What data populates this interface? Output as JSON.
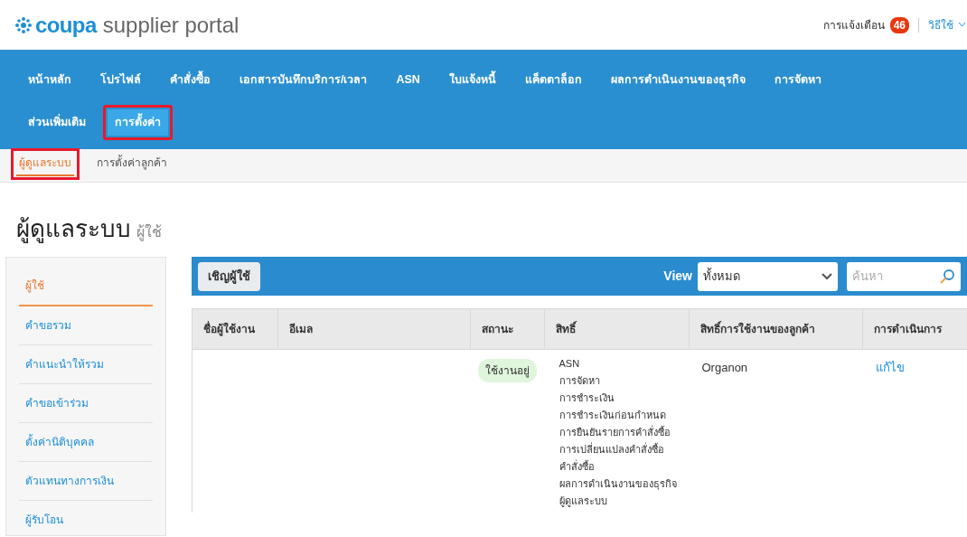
{
  "header": {
    "logo_brand": "coupa",
    "logo_product": "supplier portal",
    "notifications_label": "การแจ้งเตือน",
    "notifications_count": "46",
    "help": "วิธีใช้"
  },
  "nav": [
    {
      "label": "หน้าหลัก",
      "selected": false,
      "highlighted": false
    },
    {
      "label": "โปรไฟล์",
      "selected": false,
      "highlighted": false
    },
    {
      "label": "คำสั่งซื้อ",
      "selected": false,
      "highlighted": false
    },
    {
      "label": "เอกสารบันทึกบริการ/เวลา",
      "selected": false,
      "highlighted": false
    },
    {
      "label": "ASN",
      "selected": false,
      "highlighted": false
    },
    {
      "label": "ใบแจ้งหนี้",
      "selected": false,
      "highlighted": false
    },
    {
      "label": "แค็ตตาล็อก",
      "selected": false,
      "highlighted": false
    },
    {
      "label": "ผลการดำเนินงานของธุรกิจ",
      "selected": false,
      "highlighted": false
    },
    {
      "label": "การจัดหา",
      "selected": false,
      "highlighted": false
    },
    {
      "label": "ส่วนเพิ่มเติม",
      "selected": false,
      "highlighted": false
    },
    {
      "label": "การตั้งค่า",
      "selected": true,
      "highlighted": true
    }
  ],
  "subnav": [
    {
      "label": "ผู้ดูแลระบบ",
      "selected": true,
      "highlighted": true
    },
    {
      "label": "การตั้งค่าลูกค้า",
      "selected": false,
      "highlighted": false
    }
  ],
  "page_title": "ผู้ดูแลระบบ",
  "page_subtitle": "ผู้ใช้",
  "sidebar": {
    "items": [
      {
        "label": "ผู้ใช้",
        "selected": true
      },
      {
        "label": "คำขอรวม",
        "selected": false
      },
      {
        "label": "คำแนะนำให้รวม",
        "selected": false
      },
      {
        "label": "คำขอเข้าร่วม",
        "selected": false
      },
      {
        "label": "ตั้งค่านิติบุคคล",
        "selected": false
      },
      {
        "label": "ตัวแทนทางการเงิน",
        "selected": false
      },
      {
        "label": "ผู้รับโอน",
        "selected": false
      }
    ]
  },
  "toolbar": {
    "invite_button": "เชิญผู้ใช้",
    "view_label": "View",
    "view_value": "ทั้งหมด",
    "search": {
      "placeholder": "ค้นหา"
    }
  },
  "table": {
    "columns": [
      "ชื่อผู้ใช้งาน",
      "อีเมล",
      "สถานะ",
      "สิทธิ์",
      "สิทธิ์การใช้งานของลูกค้า",
      "การดำเนินการ"
    ],
    "rows": [
      {
        "username": "",
        "email": "",
        "status": "ใช้งานอยู่",
        "permissions": [
          "ASN",
          "การจัดหา",
          "การชำระเงิน",
          "การชำระเงินก่อนกำหนด",
          "การยืนยันรายการคำสั่งซื้อ",
          "การเปลี่ยนแปลงคำสั่งซื้อ",
          "คำสั่งซื้อ",
          "ผลการดำเนินงานของธุรกิจ",
          "ผู้ดูแลระบบ"
        ],
        "customer": "Organon",
        "action": "แก้ไข"
      }
    ]
  }
}
